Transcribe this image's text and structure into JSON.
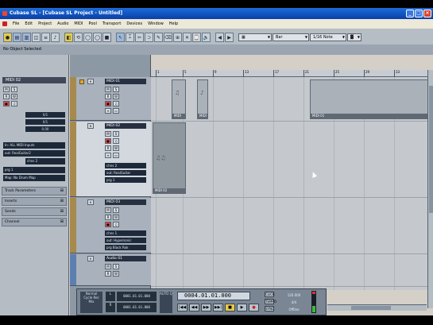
{
  "window": {
    "title": "Cubase SL - [Cubase SL Project - Untitled]",
    "controls": [
      "_",
      "□",
      "×"
    ]
  },
  "menu": [
    "File",
    "Edit",
    "Project",
    "Audio",
    "MIDI",
    "Pool",
    "Transport",
    "Devices",
    "Window",
    "Help"
  ],
  "toolbar": {
    "snap_dropdown": "Bar",
    "quantize_dropdown": "1/16 Note",
    "status": "No Object Selected"
  },
  "inspector": {
    "track_name": "MIDI 02",
    "values": [
      "0/1",
      "0/1",
      "0.00"
    ],
    "input": "In: ALL MIDI Inputs",
    "output": "out: RealGuitar2",
    "channel": "chns 2",
    "program": "prg 1",
    "drum_map": "Map: No Drum Map",
    "sections": [
      "Track Parameters",
      "Inserts",
      "Sends",
      "Channel"
    ]
  },
  "tracks": [
    {
      "name": "MIDI 01",
      "fields": []
    },
    {
      "name": "MIDI 02",
      "fields": [
        "chns 2",
        "out: RealGuitar",
        "prg 1"
      ]
    },
    {
      "name": "MIDI 03",
      "fields": [
        "chns 1",
        "out: Hypersonic",
        "prg Black Rok"
      ]
    },
    {
      "name": "Audio 01",
      "fields": []
    }
  ],
  "ruler": [
    "1",
    "5",
    "9",
    "13",
    "17",
    "21",
    "25",
    "29",
    "33"
  ],
  "parts": [
    {
      "label": "MIDI 01"
    },
    {
      "label": "MIDI 01"
    },
    {
      "label": "MIDI 01"
    },
    {
      "label": "MIDI 02"
    }
  ],
  "transport": {
    "mode_top": "Normal",
    "mode_mid": "Cycle Rec",
    "mode_bot": "Mix",
    "left_locator": "0001.01.01.000",
    "right_locator": "0001.01.01.000",
    "auto_q": "AUTO Q",
    "position": "0004.01.01.000",
    "click": "CLICK",
    "tempo_label": "TEMPO",
    "sync": "SYNC",
    "tempo_value": "120.000",
    "signature": "4/4",
    "offline": "Offline",
    "buttons": [
      "|◀◀",
      "◀◀",
      "▶▶",
      "▶▶|",
      "■",
      "▶",
      "●"
    ]
  }
}
